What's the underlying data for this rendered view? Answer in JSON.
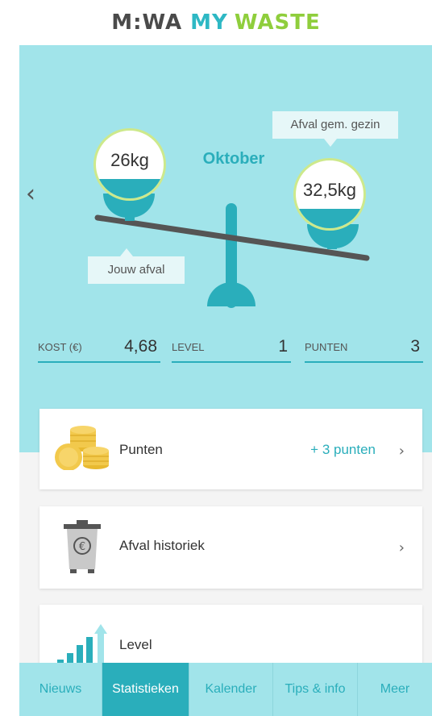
{
  "logo": {
    "part1": "M:WA",
    "part2": "MY",
    "part3": "WASTE"
  },
  "stats_header": {
    "month": "Oktober",
    "prev_glyph": "‹",
    "own_waste_label": "Jouw afval",
    "own_waste_value": "26kg",
    "avg_label": "Afval gem. gezin",
    "avg_value": "32,5kg"
  },
  "stats": {
    "cost_label": "KOST (€)",
    "cost_value": "4,68",
    "level_label": "LEVEL",
    "level_value": "1",
    "points_label": "PUNTEN",
    "points_value": "3"
  },
  "cards": {
    "points": {
      "title": "Punten",
      "extra": "+ 3 punten",
      "chevron": "›",
      "icon": "coins-icon"
    },
    "history": {
      "title": "Afval historiek",
      "chevron": "›",
      "icon": "waste-bin-euro-icon"
    },
    "level": {
      "title": "Level",
      "icon": "level-bars-icon"
    }
  },
  "tabs": [
    {
      "label": "Nieuws"
    },
    {
      "label": "Statistieken",
      "active": true
    },
    {
      "label": "Kalender"
    },
    {
      "label": "Tips & info"
    },
    {
      "label": "Meer"
    }
  ],
  "colors": {
    "accent": "#2aaebb",
    "hero_background": "#a1e4ea",
    "brand_green": "#8fce3c",
    "coin_gold": "#f2c94c"
  }
}
